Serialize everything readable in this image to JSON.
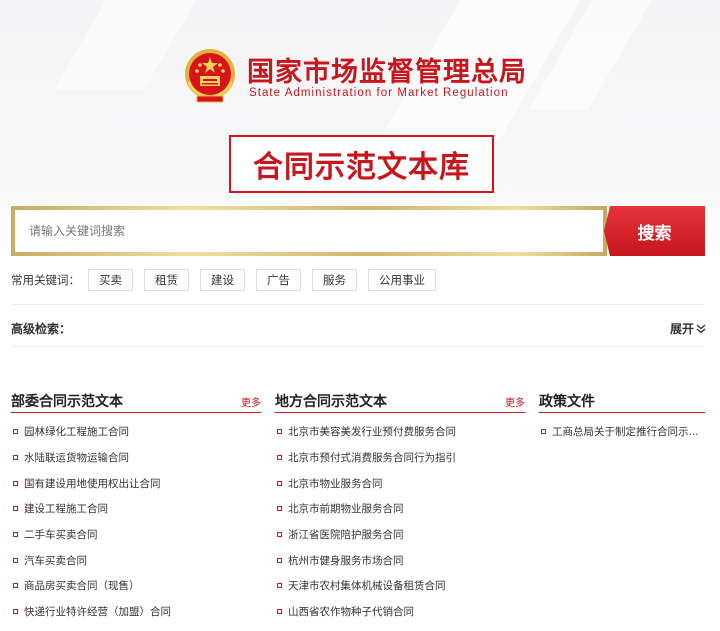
{
  "header": {
    "org_name_cn": "国家市场监督管理总局",
    "org_name_en": "State Administration for Market Regulation",
    "library_title": "合同示范文本库",
    "emblem": "national-emblem-icon"
  },
  "search": {
    "placeholder": "请输入关键词搜索",
    "button_label": "搜索"
  },
  "keywords": {
    "label": "常用关键词：",
    "tags": [
      "买卖",
      "租赁",
      "建设",
      "广告",
      "服务",
      "公用事业"
    ]
  },
  "advanced": {
    "label": "高级检索：",
    "expand_label": "展开"
  },
  "columns": [
    {
      "title": "部委合同示范文本",
      "more": "更多",
      "items": [
        "园林绿化工程施工合同",
        "水陆联运货物运输合同",
        "国有建设用地使用权出让合同",
        "建设工程施工合同",
        "二手车买卖合同",
        "汽车买卖合同",
        "商品房买卖合同（现售）",
        "快递行业特许经营（加盟）合同"
      ]
    },
    {
      "title": "地方合同示范文本",
      "more": "更多",
      "items": [
        "北京市美容美发行业预付费服务合同",
        "北京市预付式消费服务合同行为指引",
        "北京市物业服务合同",
        "北京市前期物业服务合同",
        "浙江省医院陪护服务合同",
        "杭州市健身服务市场合同",
        "天津市农村集体机械设备租赁合同",
        "山西省农作物种子代销合同"
      ]
    },
    {
      "title": "政策文件",
      "more": "",
      "items": [
        "工商总局关于制定推行合同示..."
      ]
    }
  ],
  "colors": {
    "brand_red": "#c8161d",
    "gold": "#d9bd72"
  }
}
